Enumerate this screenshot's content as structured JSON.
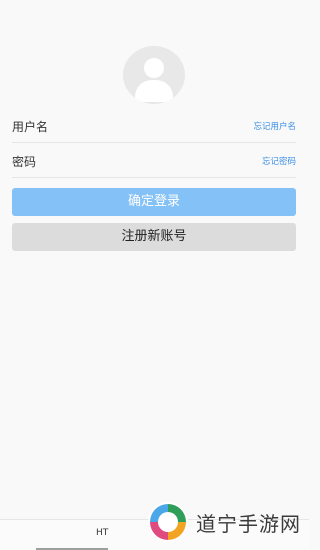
{
  "form": {
    "username_label": "用户名",
    "forgot_username": "忘记用户名",
    "password_label": "密码",
    "forgot_password": "忘记密码",
    "login_button": "确定登录",
    "register_button": "注册新账号"
  },
  "bottom": {
    "label": "HT"
  },
  "watermark": {
    "text": "道宁手游网"
  },
  "colors": {
    "accent": "#3a8ee6",
    "login_button_bg": "#84c1f6",
    "register_button_bg": "#dcdcdc"
  }
}
